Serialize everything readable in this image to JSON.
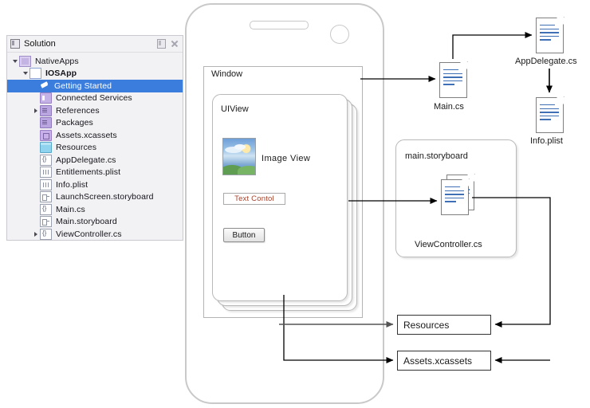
{
  "solution_panel": {
    "title": "Solution",
    "tools": [
      {
        "name": "dock-icon",
        "label": "Dock"
      },
      {
        "name": "close-icon",
        "label": "Close"
      }
    ],
    "tree": [
      {
        "label": "NativeApps",
        "icon": "solution-icon",
        "depth": 0,
        "twisty": "open",
        "selected": false,
        "bold": false
      },
      {
        "label": "IOSApp",
        "icon": "project-icon",
        "depth": 1,
        "twisty": "open",
        "selected": false,
        "bold": true
      },
      {
        "label": "Getting Started",
        "icon": "pin-icon",
        "depth": 2,
        "twisty": "none",
        "selected": true,
        "bold": false
      },
      {
        "label": "Connected Services",
        "icon": "connected-services-icon",
        "depth": 2,
        "twisty": "none",
        "selected": false,
        "bold": false
      },
      {
        "label": "References",
        "icon": "folder-icon",
        "depth": 2,
        "twisty": "collapsed",
        "selected": false,
        "bold": false
      },
      {
        "label": "Packages",
        "icon": "folder-icon",
        "depth": 2,
        "twisty": "none",
        "selected": false,
        "bold": false
      },
      {
        "label": "Assets.xcassets",
        "icon": "assets-icon",
        "depth": 2,
        "twisty": "none",
        "selected": false,
        "bold": false
      },
      {
        "label": "Resources",
        "icon": "folder-blue-icon",
        "depth": 2,
        "twisty": "none",
        "selected": false,
        "bold": false
      },
      {
        "label": "AppDelegate.cs",
        "icon": "csharp-file-icon",
        "depth": 2,
        "twisty": "none",
        "selected": false,
        "bold": false
      },
      {
        "label": "Entitlements.plist",
        "icon": "plist-file-icon",
        "depth": 2,
        "twisty": "none",
        "selected": false,
        "bold": false
      },
      {
        "label": "Info.plist",
        "icon": "plist-file-icon",
        "depth": 2,
        "twisty": "none",
        "selected": false,
        "bold": false
      },
      {
        "label": "LaunchScreen.storyboard",
        "icon": "storyboard-file-icon",
        "depth": 2,
        "twisty": "none",
        "selected": false,
        "bold": false
      },
      {
        "label": "Main.cs",
        "icon": "csharp-file-icon",
        "depth": 2,
        "twisty": "none",
        "selected": false,
        "bold": false
      },
      {
        "label": "Main.storyboard",
        "icon": "storyboard-file-icon",
        "depth": 2,
        "twisty": "none",
        "selected": false,
        "bold": false
      },
      {
        "label": "ViewController.cs",
        "icon": "csharp-file-icon",
        "depth": 2,
        "twisty": "collapsed",
        "selected": false,
        "bold": false
      }
    ]
  },
  "phone": {
    "window_label": "Window",
    "uiview_label": "UIView",
    "image_view_label": "Image View",
    "text_control_label": "Text Contol",
    "button_label": "Button"
  },
  "diagram": {
    "main_cs": "Main.cs",
    "app_delegate": "AppDelegate.cs",
    "info_plist": "Info.plist",
    "storyboard_group": "main.storyboard",
    "view_controller": "ViewController.cs",
    "resources": "Resources",
    "assets": "Assets.xcassets"
  },
  "colors": {
    "selection": "#3b7ddd",
    "panel_bg": "#f2f2f5",
    "doc_line": "#3f6fb5",
    "text_control_text": "#a8432c",
    "connector": "#000000",
    "phone_outline": "#c9c9c9"
  }
}
